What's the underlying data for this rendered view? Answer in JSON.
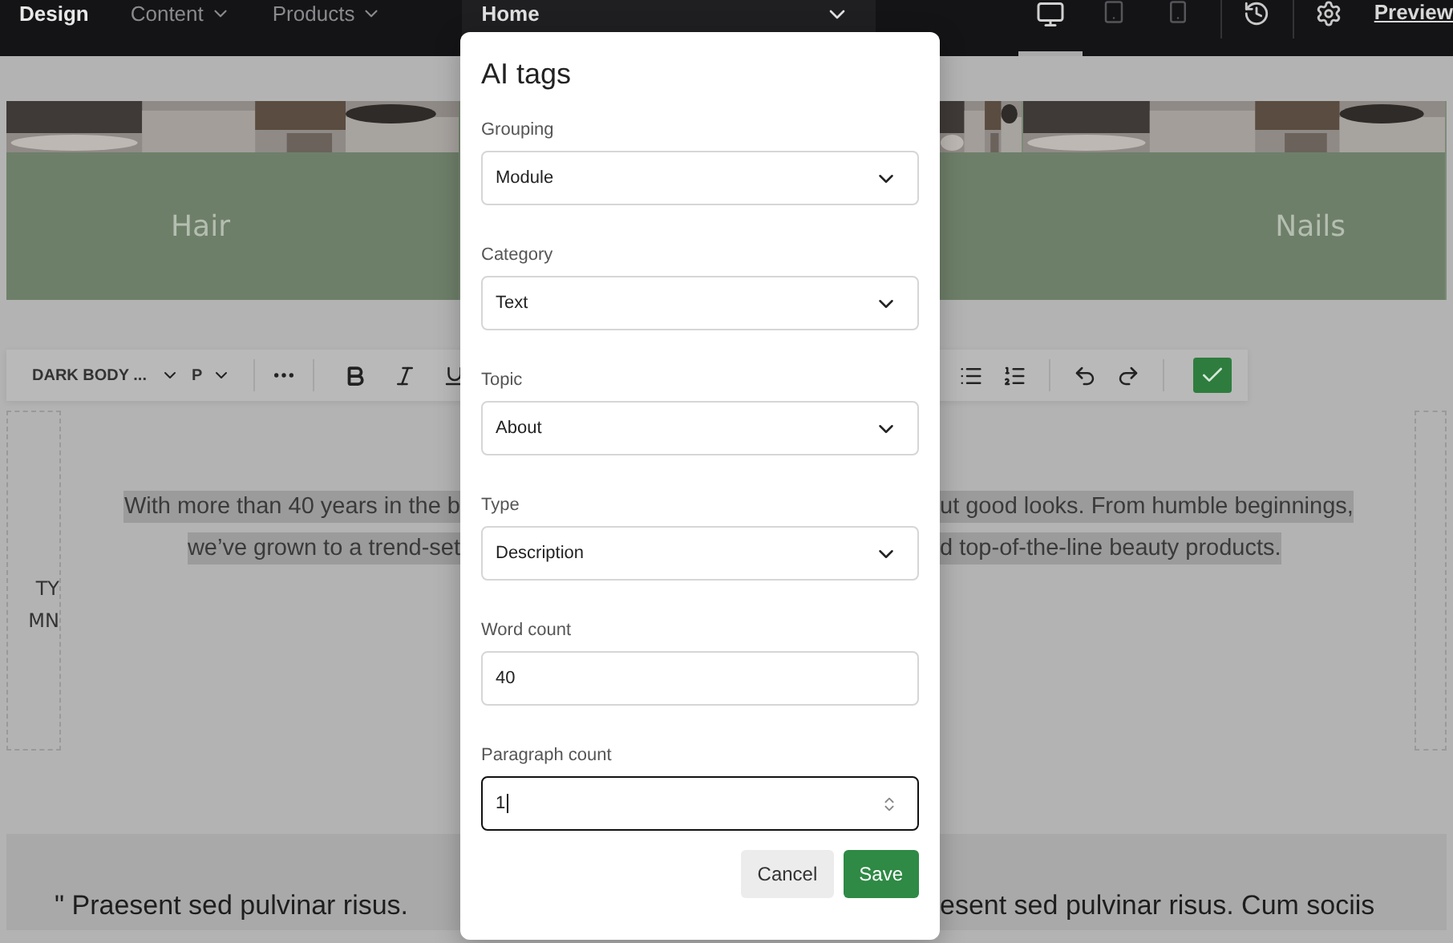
{
  "top_bar": {
    "nav": [
      {
        "label": "Design",
        "selected": true,
        "dropdown": false
      },
      {
        "label": "Content",
        "selected": false,
        "dropdown": true
      },
      {
        "label": "Products",
        "selected": false,
        "dropdown": true
      }
    ],
    "page_select": {
      "value": "Home"
    },
    "devices": [
      {
        "kind": "desktop",
        "selected": true
      },
      {
        "kind": "tablet",
        "selected": false
      },
      {
        "kind": "phone",
        "selected": false
      }
    ],
    "preview": "Preview"
  },
  "banner": {
    "tiles": [
      {
        "kind": "labeled",
        "label": "Hair"
      },
      {
        "kind": "blank"
      },
      {
        "kind": "labeled",
        "label": "Nails"
      }
    ]
  },
  "editor_toolbar": {
    "style": "DARK BODY ...",
    "tag": "P"
  },
  "left_column": {
    "lines": [
      "TY",
      "MN"
    ]
  },
  "paragraph": {
    "left_lines": [
      "With more than 40 years in the b",
      "we’ve grown to a trend-set"
    ],
    "right_lines": [
      "ut good looks. From humble beginnings,",
      "d top-of-the-line beauty products."
    ]
  },
  "quote": {
    "left": "\" Praesent sed pulvinar risus.",
    "right": "esent sed pulvinar risus. Cum sociis"
  },
  "dialog": {
    "title": "AI tags",
    "fields": [
      {
        "kind": "select",
        "label": "Grouping",
        "value": "Module",
        "focused": false
      },
      {
        "kind": "select",
        "label": "Category",
        "value": "Text",
        "focused": false
      },
      {
        "kind": "select",
        "label": "Topic",
        "value": "About",
        "focused": false
      },
      {
        "kind": "select",
        "label": "Type",
        "value": "Description",
        "focused": false
      },
      {
        "kind": "number",
        "label": "Word count",
        "value": "40",
        "focused": false
      },
      {
        "kind": "number",
        "label": "Paragraph count",
        "value": "1",
        "focused": true
      }
    ],
    "buttons": [
      {
        "kind": "secondary",
        "label": "Cancel"
      },
      {
        "kind": "primary",
        "label": "Save"
      }
    ]
  }
}
